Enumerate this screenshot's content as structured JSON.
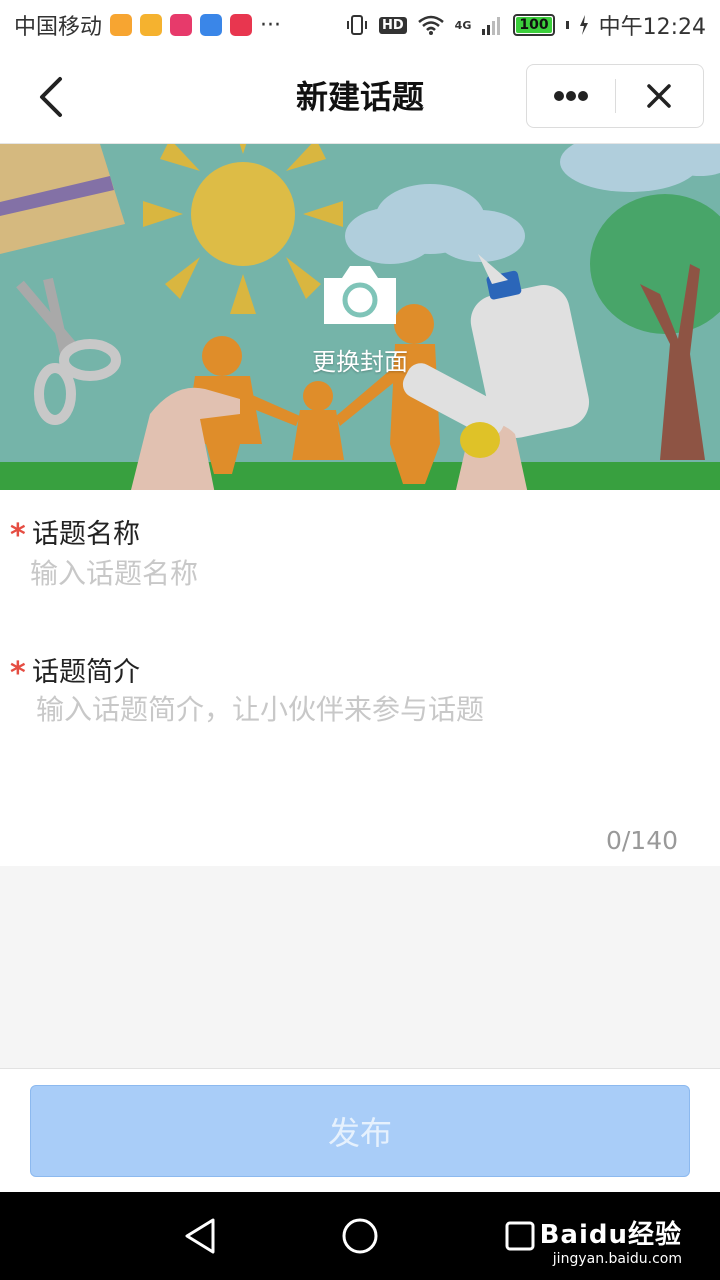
{
  "status_bar": {
    "carrier": "中国移动",
    "more_dots": "···",
    "network": "4G",
    "hd": "HD",
    "battery": "100",
    "time": "中午12:24",
    "app_icon_colors": [
      "#f7a531",
      "#f5b22f",
      "#e73a6b",
      "#3a86e8",
      "#e8364f"
    ]
  },
  "header": {
    "title": "新建话题",
    "back_icon": "chevron-left-icon",
    "more_icon": "more-dots-icon",
    "close_icon": "close-icon"
  },
  "cover": {
    "change_label": "更换封面",
    "camera_icon": "camera-icon"
  },
  "form": {
    "name_label": "话题名称",
    "name_placeholder": "输入话题名称",
    "name_value": "",
    "intro_label": "话题简介",
    "intro_placeholder": "输入话题简介，让小伙伴来参与话题",
    "intro_value": "",
    "intro_counter": "0/140",
    "required_mark": "*",
    "required_color": "#e54d42"
  },
  "footer": {
    "publish_label": "发布",
    "publish_color": "#a9cdf8"
  },
  "navbar": {
    "back_icon": "triangle-back-icon",
    "home_icon": "circle-home-icon",
    "recents_icon": "square-recents-icon"
  },
  "watermark": {
    "logo": "Baidu经验",
    "url": "jingyan.baidu.com"
  }
}
